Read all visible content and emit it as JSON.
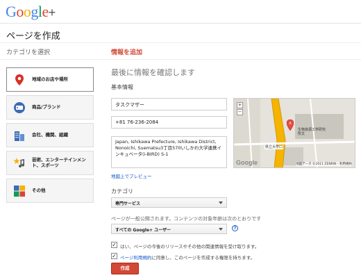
{
  "header": {
    "logo_text": "Google",
    "logo_plus": "+"
  },
  "page": {
    "title": "ページを作成"
  },
  "steps": {
    "step1": "カテゴリを選択",
    "step2": "情報を追加"
  },
  "categories": [
    {
      "label": "地域のお店や場所",
      "icon": "map-pin-icon",
      "active": true
    },
    {
      "label": "商品/ブランド",
      "icon": "tag-icon",
      "active": false
    },
    {
      "label": "会社、機関、組織",
      "icon": "building-icon",
      "active": false
    },
    {
      "label": "芸術、エンターテインメント、スポーツ",
      "icon": "star-music-icon",
      "active": false
    },
    {
      "label": "その他",
      "icon": "squares-icon",
      "active": false
    }
  ],
  "form": {
    "confirm_title": "最後に情報を確認します",
    "basic_info_label": "基本情報",
    "name_value": "タスクマザー",
    "phone_value": "+81 76-236-2084",
    "address_value": "Japan, Ishikawa Prefecture, Ishikawa District, Nonoichi, Suematsu3丁目570いしかわ大学連携インキュベータ(i-BIRD) S-1",
    "preview_link": "地図上でプレビュー",
    "category_label": "カテゴリ",
    "category_select": "専門サービス",
    "audience_note": "ページが一般公開されます。コンテンツの対象年齢は次のとおりです",
    "audience_select": "すべての Google+ ユーザー",
    "help_icon_text": "?",
    "check1_text": "はい、ページの今後のリリースやその他の関連情報を受け取ります。",
    "check2_link": "ページ利用規約",
    "check2_text": "に同意し、このページを作成する権限を持ちます。",
    "check_mark": "✓",
    "create_button": "作成"
  },
  "map": {
    "zoom_in": "+",
    "zoom_out": "−",
    "label_university": "生物資源工学研究所文",
    "label_station": "県立大学口",
    "google_text": "Google",
    "attribution": "地図データ ©2011 ZENRIN - 利用規約"
  },
  "colors": {
    "accent": "#d14836",
    "link": "#1155cc"
  }
}
